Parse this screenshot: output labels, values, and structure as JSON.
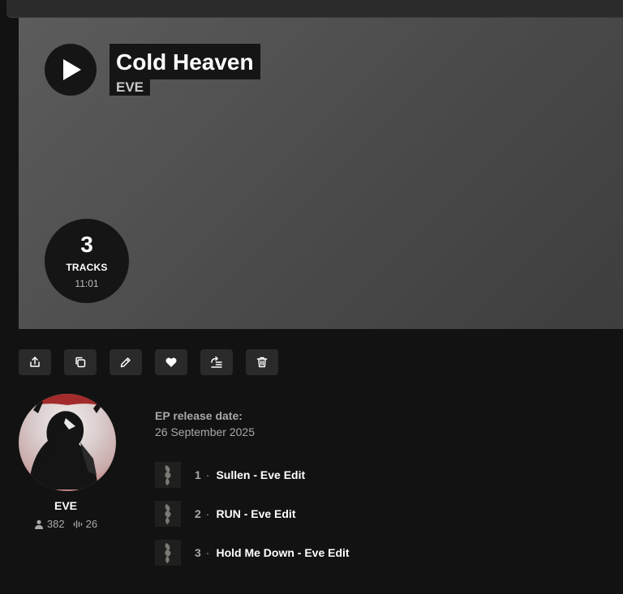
{
  "album": {
    "title": "Cold Heaven",
    "artist": "EVE",
    "track_count": "3",
    "tracks_label": "TRACKS",
    "duration": "11:01",
    "release_label": "EP release date:",
    "release_date": "26 September 2025"
  },
  "actions": [
    {
      "icon": "share-icon"
    },
    {
      "icon": "copy-icon"
    },
    {
      "icon": "edit-icon"
    },
    {
      "icon": "heart-icon"
    },
    {
      "icon": "add-to-queue-icon"
    },
    {
      "icon": "trash-icon"
    }
  ],
  "profile": {
    "name": "EVE",
    "followers": "382",
    "tracks": "26"
  },
  "tracks": [
    {
      "number": "1",
      "title": "Sullen - Eve Edit"
    },
    {
      "number": "2",
      "title": "RUN - Eve Edit"
    },
    {
      "number": "3",
      "title": "Hold Me Down - Eve Edit"
    }
  ],
  "colors": {
    "background": "#121212",
    "hero_start": "#5c5c5c",
    "hero_end": "#3e3e3e",
    "button_bg": "#2a2a2a",
    "muted_text": "#a8a8a8",
    "avatar_accent": "#b03838"
  }
}
